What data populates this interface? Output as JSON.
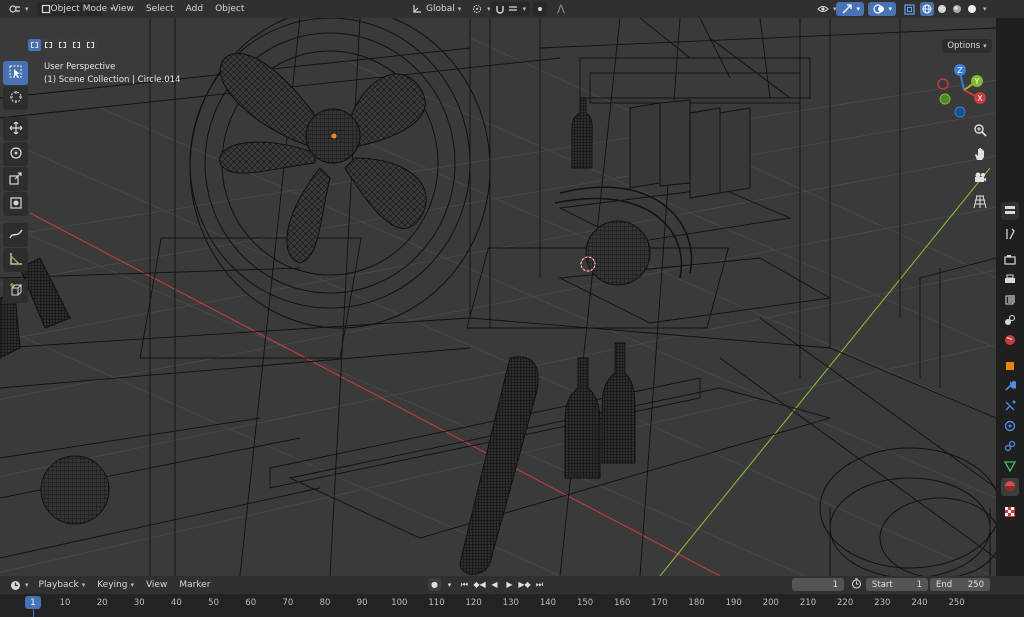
{
  "header": {
    "mode_label": "Object Mode",
    "menus": [
      "View",
      "Select",
      "Add",
      "Object"
    ],
    "transform_orientation": "Global",
    "options_label": "Options"
  },
  "viewport": {
    "perspective_label": "User Perspective",
    "collection_label": "(1) Scene Collection | Circle.014",
    "gizmo": {
      "z": "Z",
      "y": "Y",
      "x": "X"
    }
  },
  "timeline": {
    "menus": [
      "Playback",
      "Keying",
      "View",
      "Marker"
    ],
    "current_frame": "1",
    "start_label": "Start",
    "start_value": "1",
    "end_label": "End",
    "end_value": "250",
    "ruler_current": "1",
    "ruler_ticks": [
      "10",
      "20",
      "30",
      "40",
      "50",
      "60",
      "70",
      "80",
      "90",
      "100",
      "110",
      "120",
      "130",
      "140",
      "150",
      "160",
      "170",
      "180",
      "190",
      "200",
      "210",
      "220",
      "230",
      "240",
      "250"
    ]
  },
  "colors": {
    "accent": "#4772b3",
    "x_axis": "#c43c3c",
    "y_axis": "#86b82f",
    "z_axis": "#3a7fd9"
  },
  "icons": {
    "toolbar": [
      "select-box-icon",
      "cursor-icon",
      "move-icon",
      "rotate-icon",
      "scale-icon",
      "transform-icon",
      "annotate-icon",
      "measure-icon",
      "add-cube-icon"
    ],
    "nav": [
      "zoom-icon",
      "hand-pan-icon",
      "camera-icon",
      "grid-icon"
    ]
  }
}
